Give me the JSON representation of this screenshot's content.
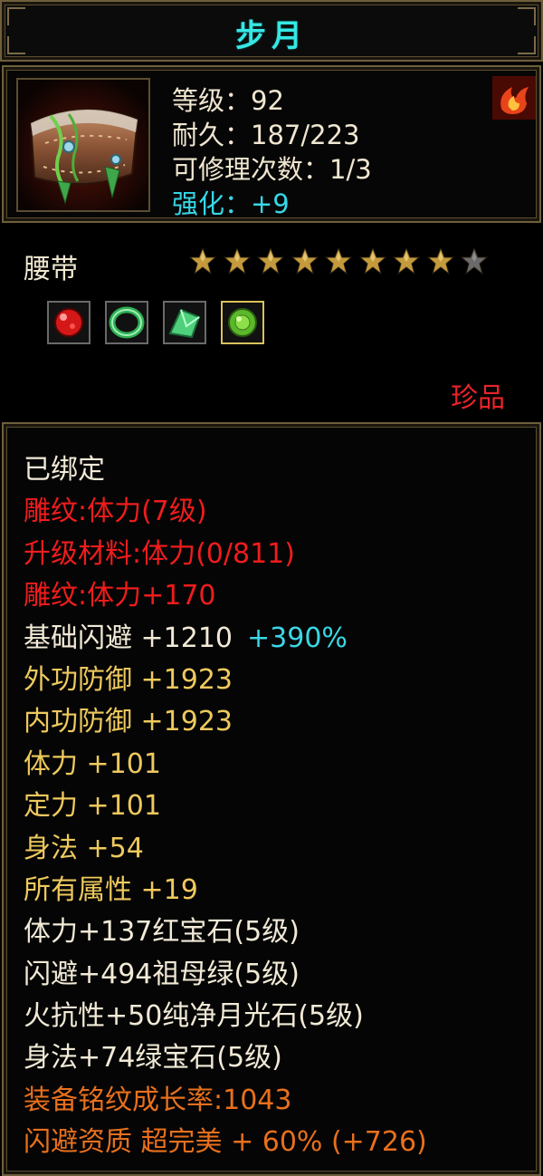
{
  "title": "步月",
  "header": {
    "level": "等级：92",
    "durability": "耐久：187/223",
    "repair_count": "可修理次数：1/3",
    "enhance": "强化：+9",
    "icon_name": "belt-item-icon",
    "element_icon": "fire-icon"
  },
  "item_type": "腰带",
  "stars": {
    "filled": 8,
    "total": 9
  },
  "gems": [
    {
      "name": "ruby-gem-icon",
      "selected": false
    },
    {
      "name": "jade-ring-icon",
      "selected": false
    },
    {
      "name": "green-crystal-icon",
      "selected": false
    },
    {
      "name": "peridot-gem-icon",
      "selected": true
    }
  ],
  "rarity": "珍品",
  "properties": [
    {
      "text": "已绑定",
      "color": "white"
    },
    {
      "text": "雕纹:体力(7级)",
      "color": "red"
    },
    {
      "text": "升级材料:体力(0/811)",
      "color": "red"
    },
    {
      "text": "雕纹:体力+170",
      "color": "red"
    },
    {
      "text": "基础闪避 +1210",
      "extra": "+390%",
      "color": "white"
    },
    {
      "text": "外功防御 +1923",
      "color": "yellow"
    },
    {
      "text": "内功防御 +1923",
      "color": "yellow"
    },
    {
      "text": "体力 +101",
      "color": "yellow"
    },
    {
      "text": "定力 +101",
      "color": "yellow"
    },
    {
      "text": "身法 +54",
      "color": "yellow"
    },
    {
      "text": "所有属性 +19",
      "color": "yellow"
    },
    {
      "text": "体力+137红宝石(5级)",
      "color": "white"
    },
    {
      "text": "闪避+494祖母绿(5级)",
      "color": "white"
    },
    {
      "text": "火抗性+50纯净月光石(5级)",
      "color": "white"
    },
    {
      "text": "身法+74绿宝石(5级)",
      "color": "white"
    },
    {
      "text": "装备铭纹成长率:1043",
      "color": "orange"
    },
    {
      "text": "闪避资质 超完美 + 60% (+726)",
      "color": "orange"
    }
  ],
  "colors": {
    "white": "#f2ead7",
    "red": "#f01c1c",
    "yellow": "#eec95d",
    "orange": "#e8701c",
    "cyan": "#3ad8e6",
    "title": "#35e8e4"
  }
}
